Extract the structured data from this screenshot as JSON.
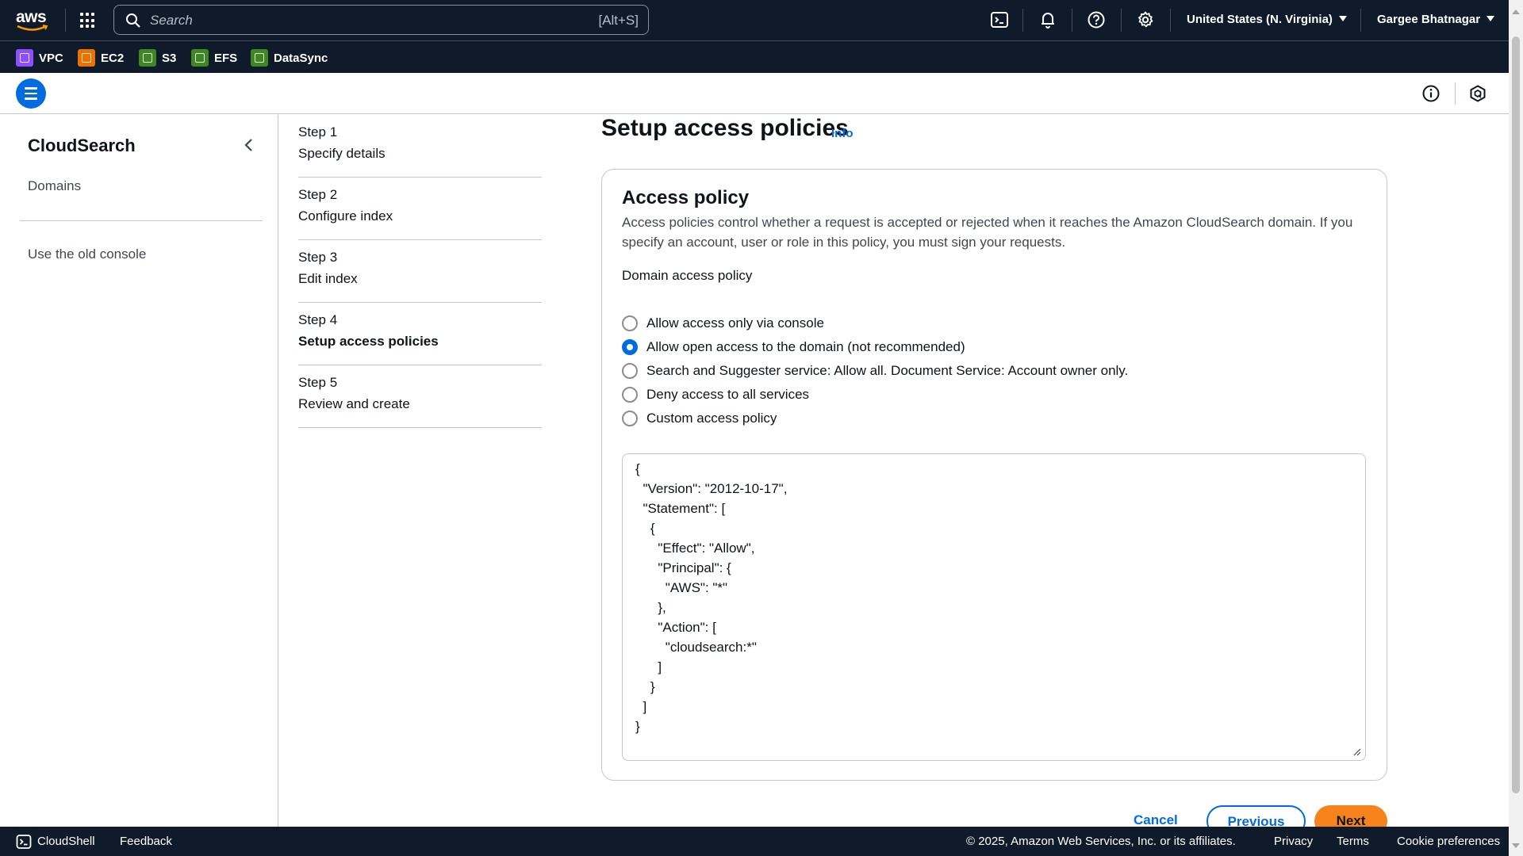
{
  "topnav": {
    "logo_text": "aws",
    "search_placeholder": "Search",
    "search_shortcut": "[Alt+S]",
    "region": "United States (N. Virginia)",
    "user": "Gargee Bhatnagar",
    "icons": [
      "cloudshell-icon",
      "bell-icon",
      "help-icon",
      "gear-icon"
    ]
  },
  "favorites": [
    {
      "label": "VPC",
      "color": "#8c4fff"
    },
    {
      "label": "EC2",
      "color": "#ed7100"
    },
    {
      "label": "S3",
      "color": "#3f8624"
    },
    {
      "label": "EFS",
      "color": "#3f8624"
    },
    {
      "label": "DataSync",
      "color": "#3f8624"
    }
  ],
  "sidenav": {
    "title": "CloudSearch",
    "items": [
      "Domains",
      "Use the old console"
    ]
  },
  "wizard": {
    "steps": [
      {
        "num": "Step 1",
        "name": "Specify details"
      },
      {
        "num": "Step 2",
        "name": "Configure index"
      },
      {
        "num": "Step 3",
        "name": "Edit index"
      },
      {
        "num": "Step 4",
        "name": "Setup access policies"
      },
      {
        "num": "Step 5",
        "name": "Review and create"
      }
    ],
    "active_step": 4
  },
  "main": {
    "title": "Setup access policies",
    "info": "Info",
    "panel": {
      "heading": "Access policy",
      "description": "Access policies control whether a request is accepted or rejected when it reaches the Amazon CloudSearch domain. If you specify an account, user or role in this policy, you must sign your requests.",
      "label": "Domain access policy",
      "options": [
        "Allow access only via console",
        "Allow open access to the domain (not recommended)",
        "Search and Suggester service: Allow all. Document Service: Account owner only.",
        "Deny access to all services",
        "Custom access policy"
      ],
      "selected_option": 1,
      "policy_json": "{\n  \"Version\": \"2012-10-17\",\n  \"Statement\": [\n    {\n      \"Effect\": \"Allow\",\n      \"Principal\": {\n        \"AWS\": \"*\"\n      },\n      \"Action\": [\n        \"cloudsearch:*\"\n      ]\n    }\n  ]\n}"
    },
    "actions": {
      "cancel": "Cancel",
      "previous": "Previous",
      "next": "Next"
    }
  },
  "footer": {
    "cloudshell": "CloudShell",
    "feedback": "Feedback",
    "copyright": "© 2025, Amazon Web Services, Inc. or its affiliates.",
    "privacy": "Privacy",
    "terms": "Terms",
    "cookies": "Cookie preferences"
  },
  "colors": {
    "nav_bg": "#0f1b2a",
    "link_blue": "#006ce0",
    "primary_orange": "#f7831c"
  }
}
